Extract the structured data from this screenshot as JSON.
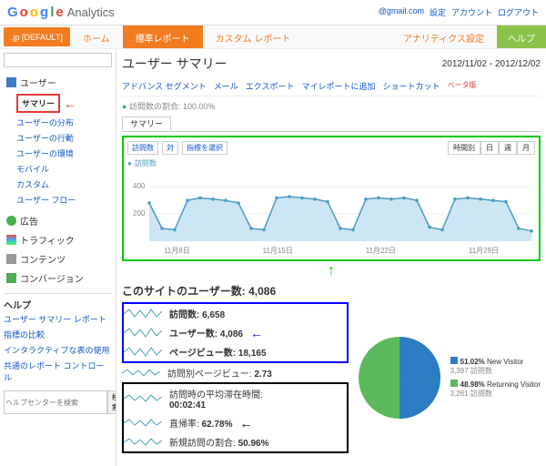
{
  "header": {
    "email": "@gmail.com",
    "links": [
      "設定",
      "アカウント",
      "ログアウト"
    ]
  },
  "nav": {
    "badge": ".jp [DEFAULT]",
    "tabs": [
      "ホーム",
      "標準レポート",
      "カスタム レポート"
    ],
    "right": [
      "アナリティクス設定",
      "ヘルプ"
    ]
  },
  "side": {
    "search_ph": "",
    "groups": [
      {
        "label": "ユーザー",
        "items": [
          "サマリー",
          "ユーザーの分布",
          "ユーザーの行動",
          "ユーザーの環境",
          "モバイル",
          "カスタム",
          "ユーザー フロー"
        ]
      },
      {
        "label": "広告"
      },
      {
        "label": "トラフィック"
      },
      {
        "label": "コンテンツ"
      },
      {
        "label": "コンバージョン"
      }
    ],
    "help_title": "ヘルプ",
    "help": [
      "ユーザー サマリー レポート",
      "指標の比較",
      "インタラクティブな表の使用",
      "共通のレポート コントロール"
    ],
    "help_search_ph": "ヘルプセンターを検索",
    "help_btn": "検索"
  },
  "main": {
    "title": "ユーザー サマリー",
    "date": "2012/11/02 - 2012/12/02",
    "toolbar": [
      "アドバンス セグメント",
      "メール",
      "エクスポート",
      "マイレポートに追加",
      "ショートカット"
    ],
    "beta": "ベータ版",
    "pct": "訪問数の割合: 100.00%",
    "tab": "サマリー",
    "chart": {
      "sel": [
        "訪問数",
        "対",
        "指標を選択"
      ],
      "gran": [
        "時間別",
        "日",
        "週",
        "月"
      ],
      "legend": "訪問数",
      "y": [
        "400",
        "200"
      ],
      "x": [
        "11月8日",
        "11月15日",
        "11月22日",
        "11月29日"
      ]
    },
    "users_title": "このサイトのユーザー数: 4,086",
    "m": [
      {
        "l": "訪問数:",
        "v": "6,658"
      },
      {
        "l": "ユーザー数:",
        "v": "4,086"
      },
      {
        "l": "ページビュー数:",
        "v": "18,165"
      },
      {
        "l": "訪問別ページビュー:",
        "v": "2.73"
      },
      {
        "l": "訪問時の平均滞在時間:",
        "v": "00:02:41"
      },
      {
        "l": "直帰率:",
        "v": "62.78%"
      },
      {
        "l": "新規訪問の割合:",
        "v": "50.96%"
      }
    ],
    "pie": [
      {
        "pct": "51.02%",
        "l": "New Visitor",
        "sub": "3,397 訪問数"
      },
      {
        "pct": "48.98%",
        "l": "Returning Visitor",
        "sub": "3,261 訪問数"
      }
    ]
  },
  "chart_data": {
    "type": "line",
    "title": "訪問数",
    "ylim": [
      0,
      500
    ],
    "x": [
      "11/2",
      "11/3",
      "11/4",
      "11/5",
      "11/6",
      "11/7",
      "11/8",
      "11/9",
      "11/10",
      "11/11",
      "11/12",
      "11/13",
      "11/14",
      "11/15",
      "11/16",
      "11/17",
      "11/18",
      "11/19",
      "11/20",
      "11/21",
      "11/22",
      "11/23",
      "11/24",
      "11/25",
      "11/26",
      "11/27",
      "11/28",
      "11/29",
      "11/30",
      "12/1",
      "12/2"
    ],
    "values": [
      300,
      100,
      90,
      320,
      340,
      330,
      320,
      300,
      100,
      90,
      340,
      350,
      340,
      330,
      310,
      100,
      90,
      330,
      340,
      330,
      340,
      320,
      110,
      90,
      330,
      340,
      330,
      320,
      310,
      100,
      80
    ]
  }
}
